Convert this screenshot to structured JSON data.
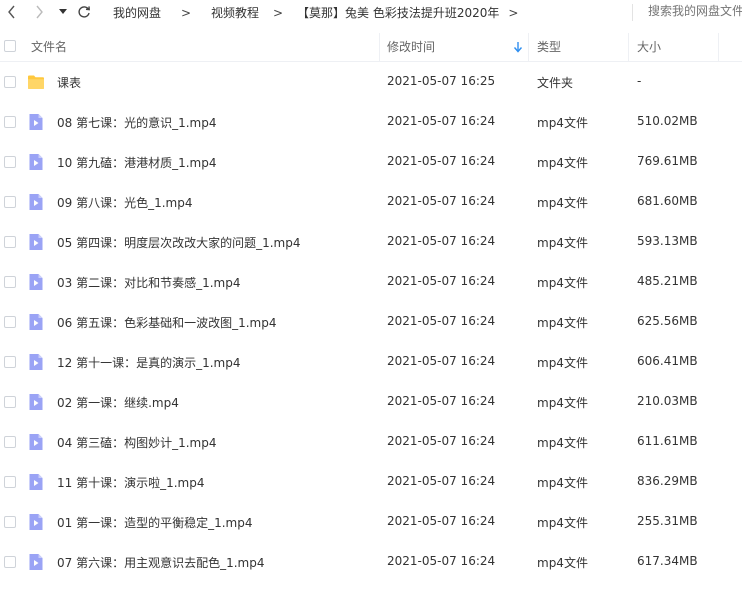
{
  "nav": {
    "breadcrumbs": [
      "我的网盘",
      "视频教程",
      "【莫那】兔美 色彩技法提升班2020年"
    ],
    "separator": ">",
    "search_placeholder": "搜索我的网盘文件"
  },
  "columns": {
    "name": "文件名",
    "modified": "修改时间",
    "type": "类型",
    "size": "大小"
  },
  "colors": {
    "folder": "#ffc83d",
    "video": "#9aa3f5",
    "sort_arrow": "#2f8ff0"
  },
  "files": [
    {
      "name": "课表",
      "modified": "2021-05-07 16:25",
      "type": "文件夹",
      "size": "-",
      "icon": "folder-icon"
    },
    {
      "name": "08 第七课：光的意识_1.mp4",
      "modified": "2021-05-07 16:24",
      "type": "mp4文件",
      "size": "510.02MB",
      "icon": "video-file-icon"
    },
    {
      "name": "10 第九磕：港港材质_1.mp4",
      "modified": "2021-05-07 16:24",
      "type": "mp4文件",
      "size": "769.61MB",
      "icon": "video-file-icon"
    },
    {
      "name": "09 第八课：光色_1.mp4",
      "modified": "2021-05-07 16:24",
      "type": "mp4文件",
      "size": "681.60MB",
      "icon": "video-file-icon"
    },
    {
      "name": "05 第四课：明度层次改改大家的问题_1.mp4",
      "modified": "2021-05-07 16:24",
      "type": "mp4文件",
      "size": "593.13MB",
      "icon": "video-file-icon"
    },
    {
      "name": "03 第二课：对比和节奏感_1.mp4",
      "modified": "2021-05-07 16:24",
      "type": "mp4文件",
      "size": "485.21MB",
      "icon": "video-file-icon"
    },
    {
      "name": "06 第五课：色彩基础和一波改图_1.mp4",
      "modified": "2021-05-07 16:24",
      "type": "mp4文件",
      "size": "625.56MB",
      "icon": "video-file-icon"
    },
    {
      "name": "12 第十一课：是真的演示_1.mp4",
      "modified": "2021-05-07 16:24",
      "type": "mp4文件",
      "size": "606.41MB",
      "icon": "video-file-icon"
    },
    {
      "name": "02 第一课：继续.mp4",
      "modified": "2021-05-07 16:24",
      "type": "mp4文件",
      "size": "210.03MB",
      "icon": "video-file-icon"
    },
    {
      "name": "04 第三磕：构图妙计_1.mp4",
      "modified": "2021-05-07 16:24",
      "type": "mp4文件",
      "size": "611.61MB",
      "icon": "video-file-icon"
    },
    {
      "name": "11 第十课：演示啦_1.mp4",
      "modified": "2021-05-07 16:24",
      "type": "mp4文件",
      "size": "836.29MB",
      "icon": "video-file-icon"
    },
    {
      "name": "01 第一课：造型的平衡稳定_1.mp4",
      "modified": "2021-05-07 16:24",
      "type": "mp4文件",
      "size": "255.31MB",
      "icon": "video-file-icon"
    },
    {
      "name": "07 第六课：用主观意识去配色_1.mp4",
      "modified": "2021-05-07 16:24",
      "type": "mp4文件",
      "size": "617.34MB",
      "icon": "video-file-icon"
    }
  ]
}
